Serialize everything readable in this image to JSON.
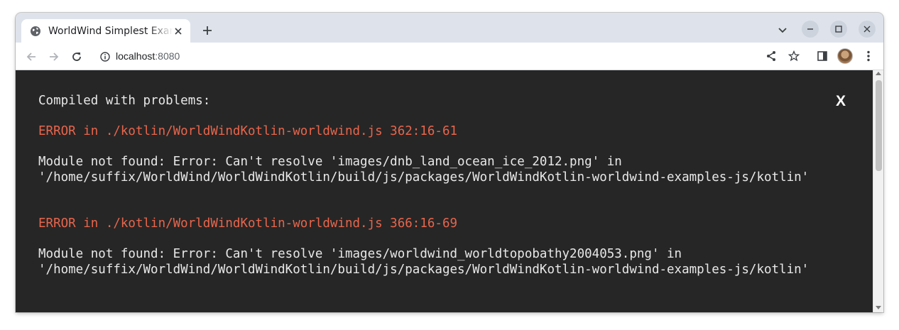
{
  "tab": {
    "title": "WorldWind Simplest Example",
    "favicon": "globe-icon"
  },
  "toolbar": {
    "url_host": "localhost",
    "url_port": ":8080"
  },
  "overlay": {
    "heading": "Compiled with problems:",
    "close_label": "X",
    "errors": [
      {
        "title": "ERROR in ./kotlin/WorldWindKotlin-worldwind.js 362:16-61",
        "message_line1": "Module not found: Error: Can't resolve 'images/dnb_land_ocean_ice_2012.png' in",
        "message_line2": "'/home/suffix/WorldWind/WorldWindKotlin/build/js/packages/WorldWindKotlin-worldwind-examples-js/kotlin'"
      },
      {
        "title": "ERROR in ./kotlin/WorldWindKotlin-worldwind.js 366:16-69",
        "message_line1": "Module not found: Error: Can't resolve 'images/worldwind_worldtopobathy2004053.png' in",
        "message_line2": "'/home/suffix/WorldWind/WorldWindKotlin/build/js/packages/WorldWindKotlin-worldwind-examples-js/kotlin'"
      }
    ]
  },
  "colors": {
    "overlay_bg": "#262626",
    "error_title": "#e8654c",
    "text": "#e8e8e8",
    "tabstrip_bg": "#dee3eb"
  }
}
